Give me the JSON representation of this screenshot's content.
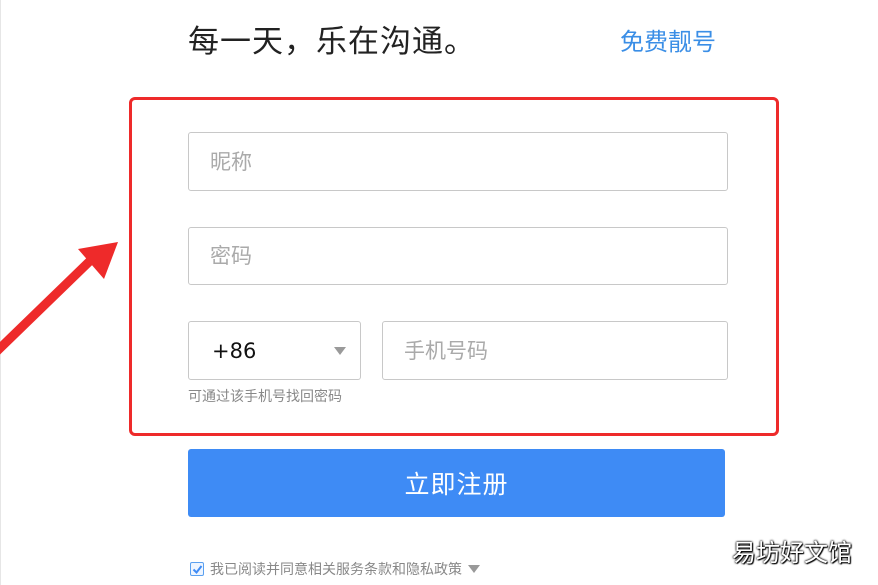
{
  "header": {
    "slogan": "每一天，乐在沟通。",
    "pretty_number_link": "免费靓号"
  },
  "form": {
    "nickname_placeholder": "昵称",
    "password_placeholder": "密码",
    "country_code": "+86",
    "phone_placeholder": "手机号码",
    "phone_hint": "可通过该手机号找回密码",
    "register_label": "立即注册",
    "agree_checked": true,
    "agree_label": "我已阅读并同意相关服务条款和隐私政策"
  },
  "annotation": {
    "highlight_color": "#ee2a2a"
  },
  "colors": {
    "accent": "#3e8bf5",
    "link": "#3a8ee6"
  },
  "watermark": "易坊好文馆"
}
